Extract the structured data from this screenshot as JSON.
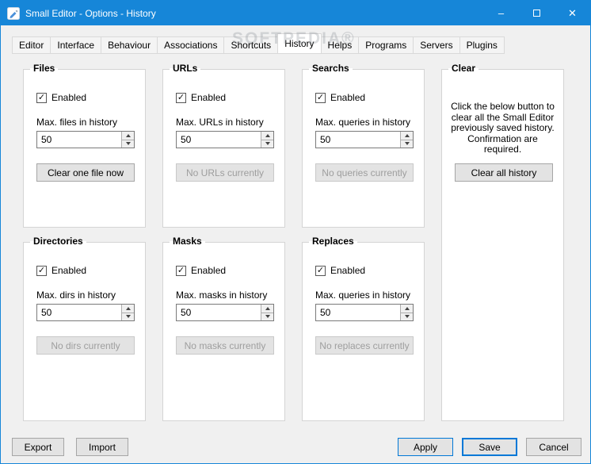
{
  "window": {
    "title": "Small Editor - Options - History",
    "minimize_glyph": "–",
    "close_glyph": "✕"
  },
  "watermark": "SOFTPEDIA®",
  "tabs": [
    "Editor",
    "Interface",
    "Behaviour",
    "Associations",
    "Shortcuts",
    "History",
    "Helps",
    "Programs",
    "Servers",
    "Plugins"
  ],
  "active_tab": "History",
  "groups": {
    "files": {
      "title": "Files",
      "enabled_label": "Enabled",
      "enabled_checked": true,
      "max_label": "Max. files in history",
      "value": "50",
      "button_label": "Clear one file now",
      "button_disabled": false
    },
    "urls": {
      "title": "URLs",
      "enabled_label": "Enabled",
      "enabled_checked": true,
      "max_label": "Max. URLs in history",
      "value": "50",
      "button_label": "No URLs currently",
      "button_disabled": true
    },
    "searchs": {
      "title": "Searchs",
      "enabled_label": "Enabled",
      "enabled_checked": true,
      "max_label": "Max. queries in history",
      "value": "50",
      "button_label": "No queries currently",
      "button_disabled": true
    },
    "clear": {
      "title": "Clear",
      "text": "Click the below button to clear all the Small Editor previously saved history. Confirmation are required.",
      "button_label": "Clear all history",
      "button_disabled": false
    },
    "directories": {
      "title": "Directories",
      "enabled_label": "Enabled",
      "enabled_checked": true,
      "max_label": "Max. dirs in history",
      "value": "50",
      "button_label": "No dirs currently",
      "button_disabled": true
    },
    "masks": {
      "title": "Masks",
      "enabled_label": "Enabled",
      "enabled_checked": true,
      "max_label": "Max. masks in history",
      "value": "50",
      "button_label": "No masks currently",
      "button_disabled": true
    },
    "replaces": {
      "title": "Replaces",
      "enabled_label": "Enabled",
      "enabled_checked": true,
      "max_label": "Max. queries in history",
      "value": "50",
      "button_label": "No replaces currently",
      "button_disabled": true
    }
  },
  "footer": {
    "export": "Export",
    "import": "Import",
    "apply": "Apply",
    "save": "Save",
    "cancel": "Cancel"
  },
  "colors": {
    "titlebar": "#1686d8",
    "accent": "#0078d7",
    "dialog_bg": "#f0f0f0"
  }
}
